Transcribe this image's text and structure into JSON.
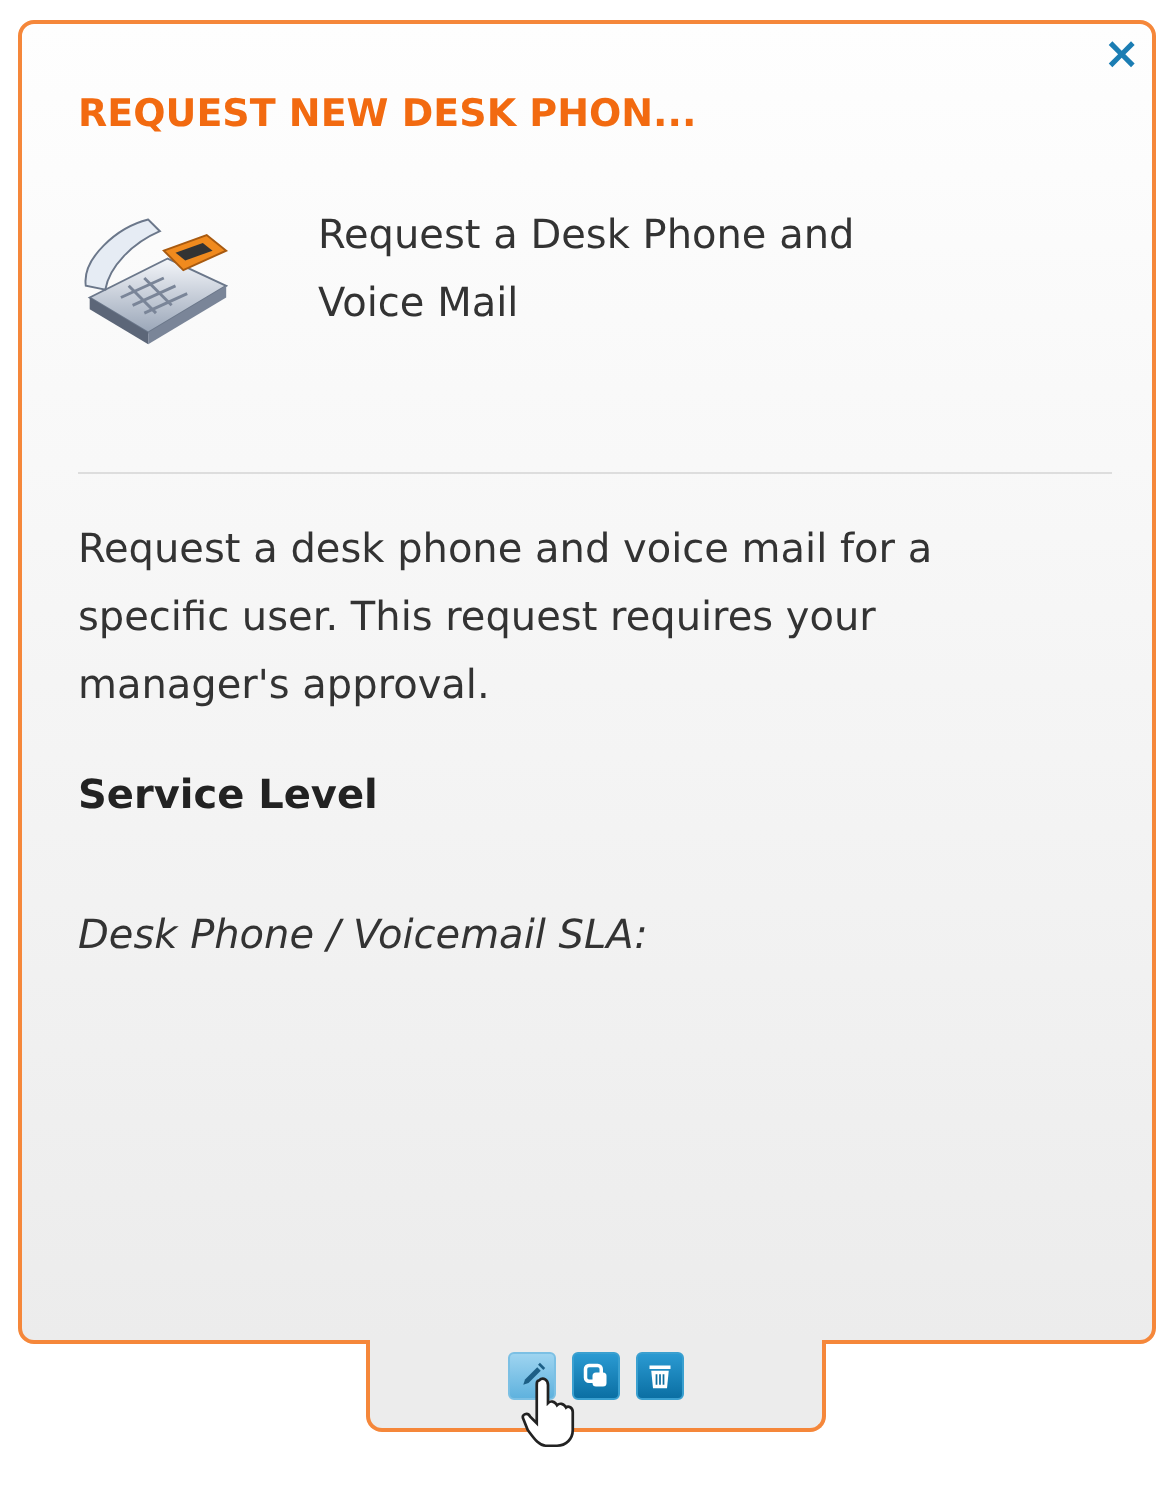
{
  "card": {
    "title": "REQUEST NEW DESK PHON...",
    "close": "×",
    "subtitle": "Request a Desk Phone and Voice Mail",
    "description": "Request a desk phone and voice mail for a specific user. This request requires your manager's approval.",
    "section_heading": "Service Level",
    "sla": "Desk Phone / Voicemail SLA:"
  },
  "actions": [
    {
      "kind": "edit",
      "highlighted": true
    },
    {
      "kind": "copy",
      "highlighted": false
    },
    {
      "kind": "delete",
      "highlighted": false
    }
  ]
}
